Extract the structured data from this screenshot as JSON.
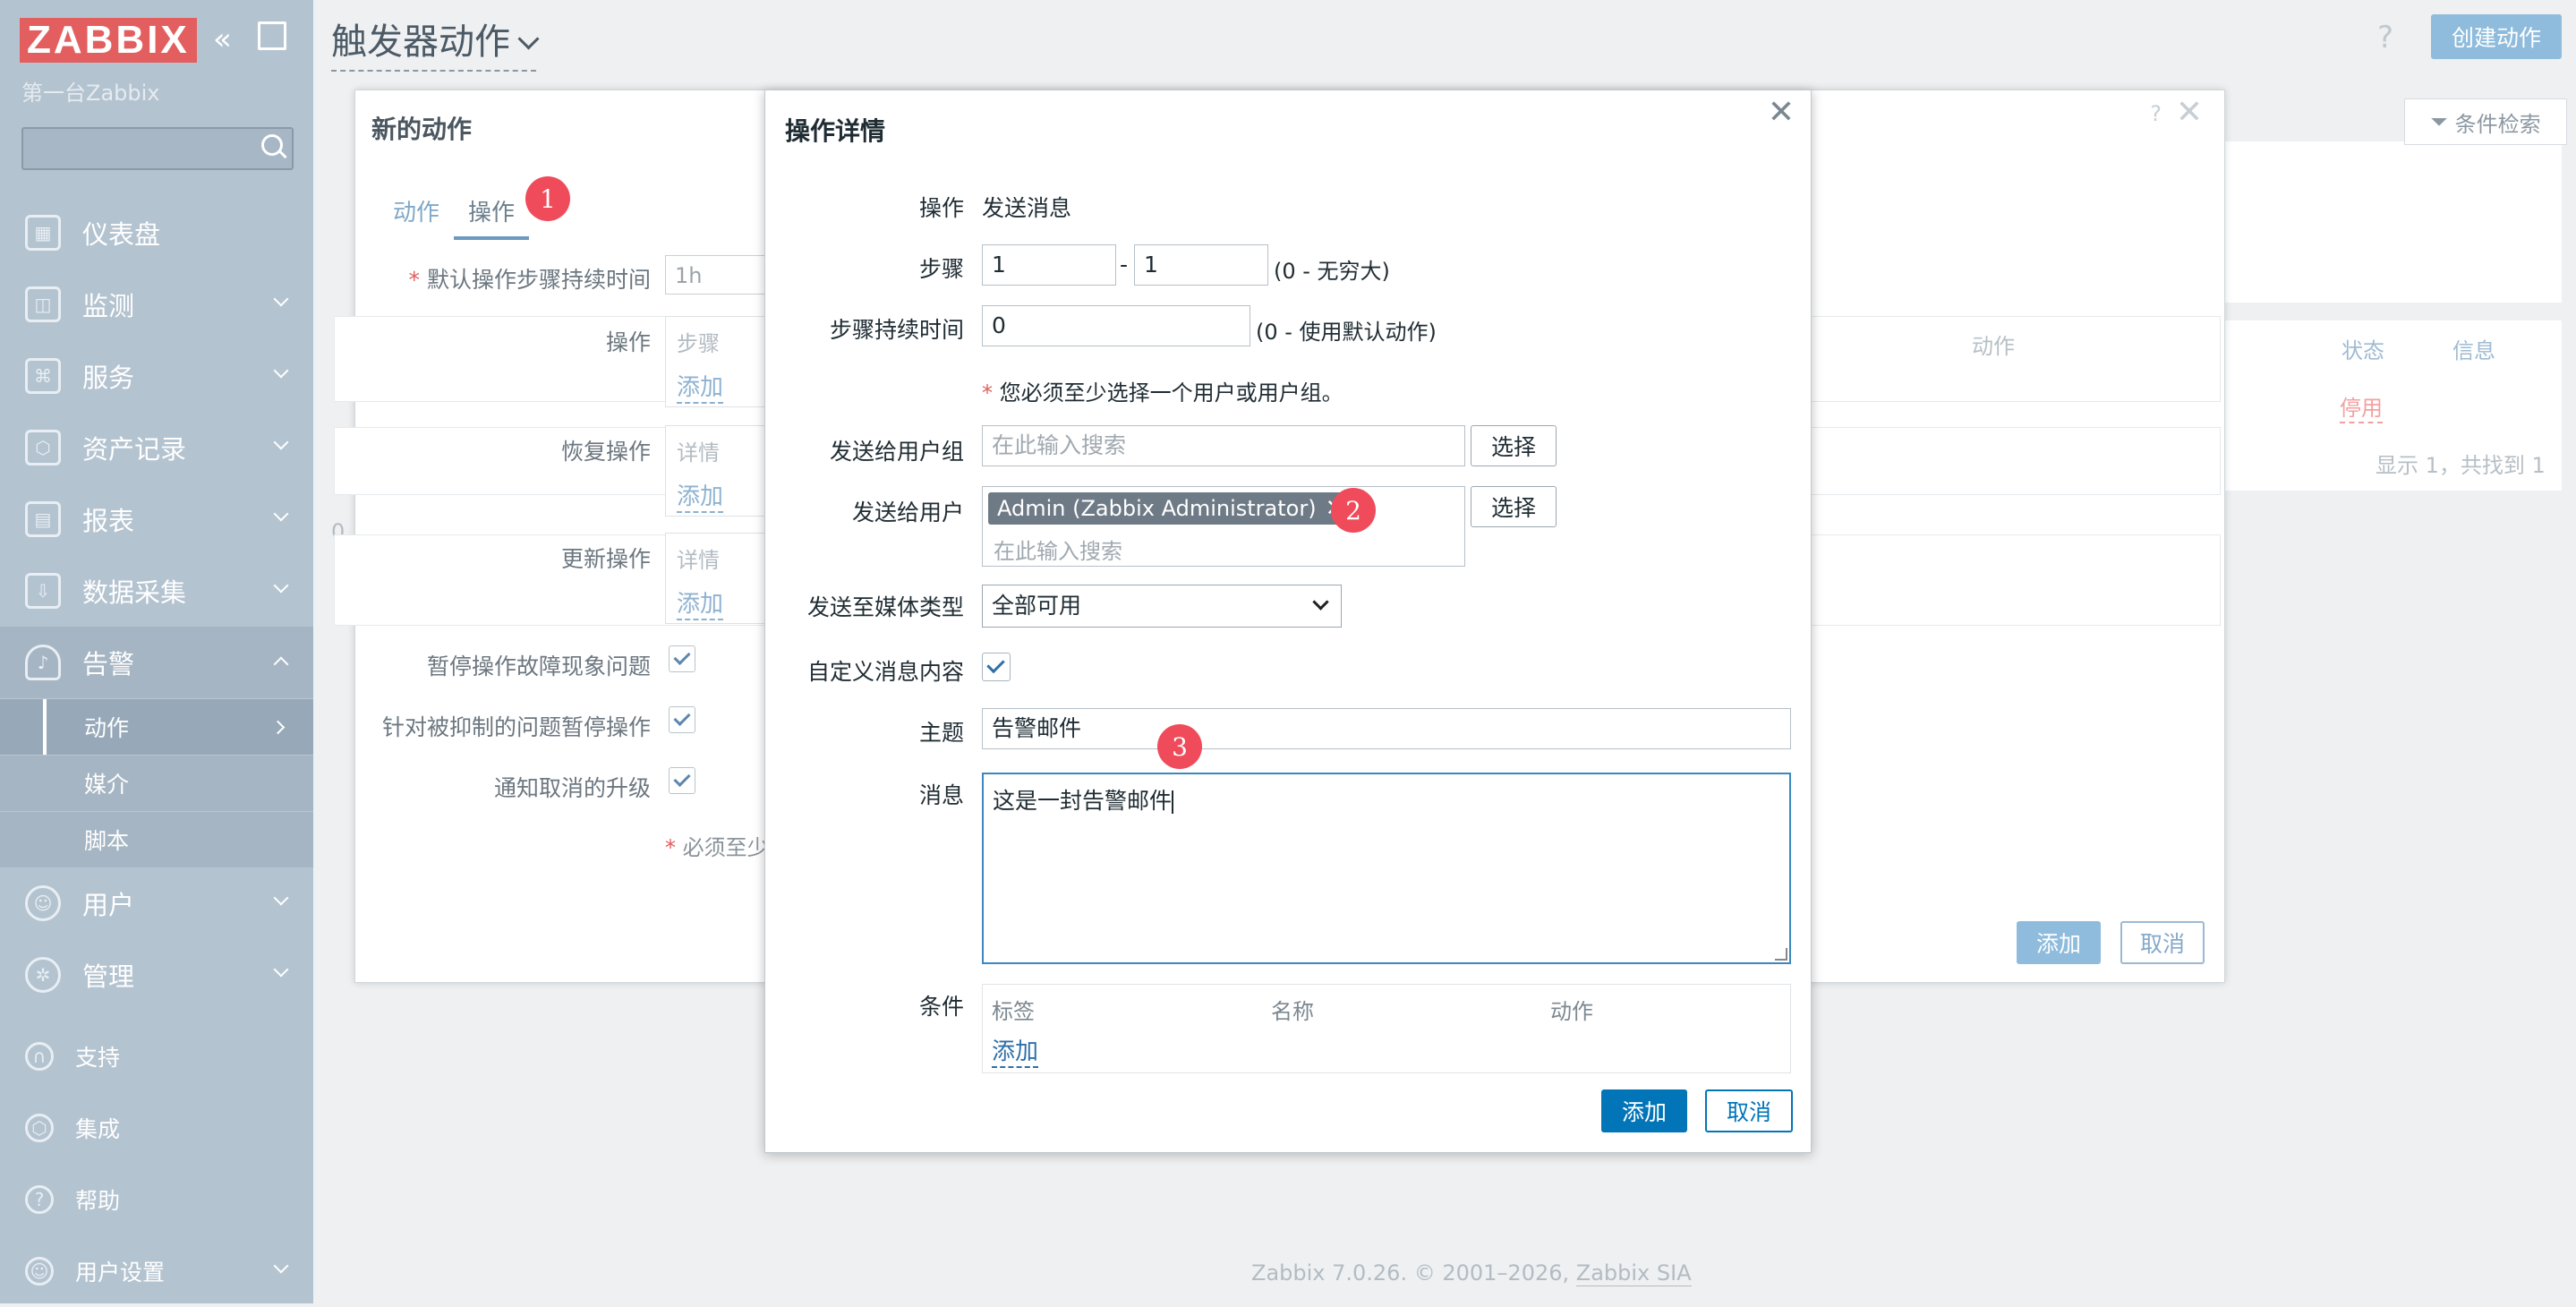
{
  "app": {
    "logo": "ZABBIX",
    "server_name": "第一台Zabbix",
    "page_title": "触发器动作",
    "create_button": "创建动作",
    "help": "?",
    "footer_version": "Zabbix 7.0.26. © 2001–2026, ",
    "footer_link": "Zabbix SIA"
  },
  "sidebar": {
    "items": [
      {
        "label": "仪表盘",
        "icon": "dashboard-icon"
      },
      {
        "label": "监测",
        "icon": "monitoring-icon"
      },
      {
        "label": "服务",
        "icon": "services-icon"
      },
      {
        "label": "资产记录",
        "icon": "inventory-icon"
      },
      {
        "label": "报表",
        "icon": "reports-icon"
      },
      {
        "label": "数据采集",
        "icon": "data-collection-icon"
      },
      {
        "label": "告警",
        "icon": "bell-icon"
      }
    ],
    "alerts_sub": [
      "动作",
      "媒介",
      "脚本"
    ],
    "items_after": [
      {
        "label": "用户",
        "icon": "users-icon"
      },
      {
        "label": "管理",
        "icon": "gear-icon"
      }
    ],
    "bottom": [
      {
        "label": "支持",
        "icon": "headset-icon"
      },
      {
        "label": "集成",
        "icon": "integrations-icon"
      },
      {
        "label": "帮助",
        "icon": "help-icon"
      },
      {
        "label": "用户设置",
        "icon": "user-settings-icon"
      }
    ]
  },
  "background": {
    "filter_label": "条件检索",
    "col_action": "动作",
    "col_status": "状态",
    "col_info": "信息",
    "status_value": "停用",
    "count": "显示 1，共找到 1",
    "left_zero": "0"
  },
  "new_action_dialog": {
    "title": "新的动作",
    "help": "?",
    "close": "✕",
    "tabs": [
      "动作",
      "操作"
    ],
    "markers": [
      "1",
      "2",
      "3"
    ],
    "default_duration_label": "默认操作步骤持续时间",
    "default_duration_value": "1h",
    "operations_label": "操作",
    "operations_header": "步骤",
    "operations_add": "添加",
    "recovery_label": "恢复操作",
    "recovery_header": "详情",
    "recovery_add": "添加",
    "update_label": "更新操作",
    "update_header": "详情",
    "update_add": "添加",
    "pause_symptoms": "暂停操作故障现象问题",
    "pause_suppressed": "针对被抑制的问题暂停操作",
    "notify_cancelled": "通知取消的升级",
    "required_note": "必须至少",
    "add_button": "添加",
    "cancel_button": "取消"
  },
  "operation_dialog": {
    "title": "操作详情",
    "close": "✕",
    "operation_label": "操作",
    "operation_value": "发送消息",
    "steps_label": "步骤",
    "step_from": "1",
    "step_to": "1",
    "step_sep": "-",
    "steps_hint": "(0 - 无穷大)",
    "step_duration_label": "步骤持续时间",
    "step_duration_value": "0",
    "step_duration_hint": "(0 - 使用默认动作)",
    "required_note": "您必须至少选择一个用户或用户组。",
    "send_groups_label": "发送给用户组",
    "search_placeholder": "在此输入搜索",
    "select_button": "选择",
    "send_users_label": "发送给用户",
    "user_chip": "Admin (Zabbix Administrator)",
    "media_label": "发送至媒体类型",
    "media_value": "全部可用",
    "custom_message_label": "自定义消息内容",
    "subject_label": "主题",
    "subject_value": "告警邮件",
    "message_label": "消息",
    "message_value": "这是一封告警邮件",
    "conditions_label": "条件",
    "cond_cols": [
      "标签",
      "名称",
      "动作"
    ],
    "cond_add": "添加",
    "add_button": "添加",
    "cancel_button": "取消"
  }
}
